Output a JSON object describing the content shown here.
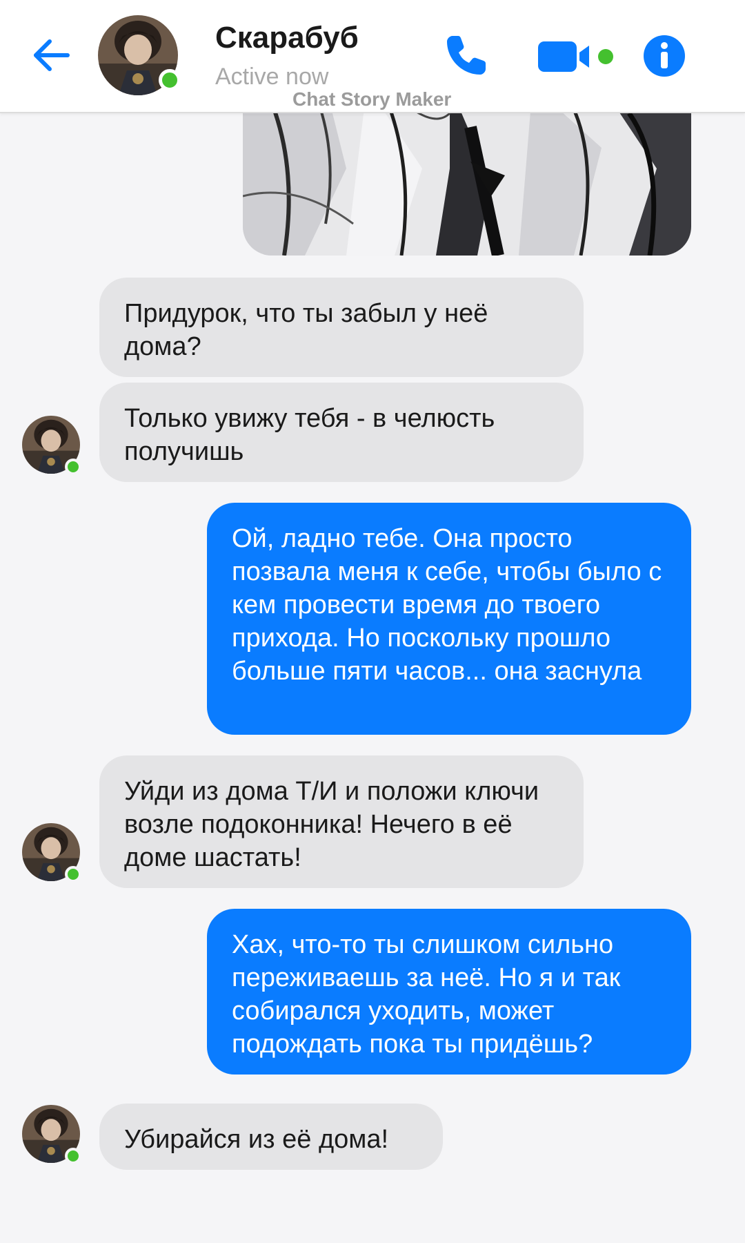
{
  "header": {
    "contact_name": "Скарабуб",
    "status": "Active now",
    "watermark": "Chat Story Maker",
    "accent_color": "#0a7cff",
    "online_color": "#44c02f",
    "icons": [
      "back-arrow-icon",
      "phone-icon",
      "video-camera-icon",
      "info-icon"
    ]
  },
  "messages": [
    {
      "side": "in",
      "text": "Придурок, что ты забыл у неё дома?"
    },
    {
      "side": "in",
      "text": "Только увижу тебя - в челюсть получишь"
    },
    {
      "side": "out",
      "text": "Ой, ладно тебе. Она просто позвала меня к себе, чтобы было с кем провести время до твоего прихода. Но поскольку прошло больше пяти часов... она заснула"
    },
    {
      "side": "in",
      "text": "Уйди из дома Т/И и положи ключи возле подоконника! Нечего в её доме шастать!"
    },
    {
      "side": "out",
      "text": "Хах, что-то ты слишком сильно переживаешь за неё. Но я и так собирался уходить, может подождать пока ты придёшь?"
    },
    {
      "side": "in",
      "text": "Убирайся из её дома!"
    }
  ]
}
